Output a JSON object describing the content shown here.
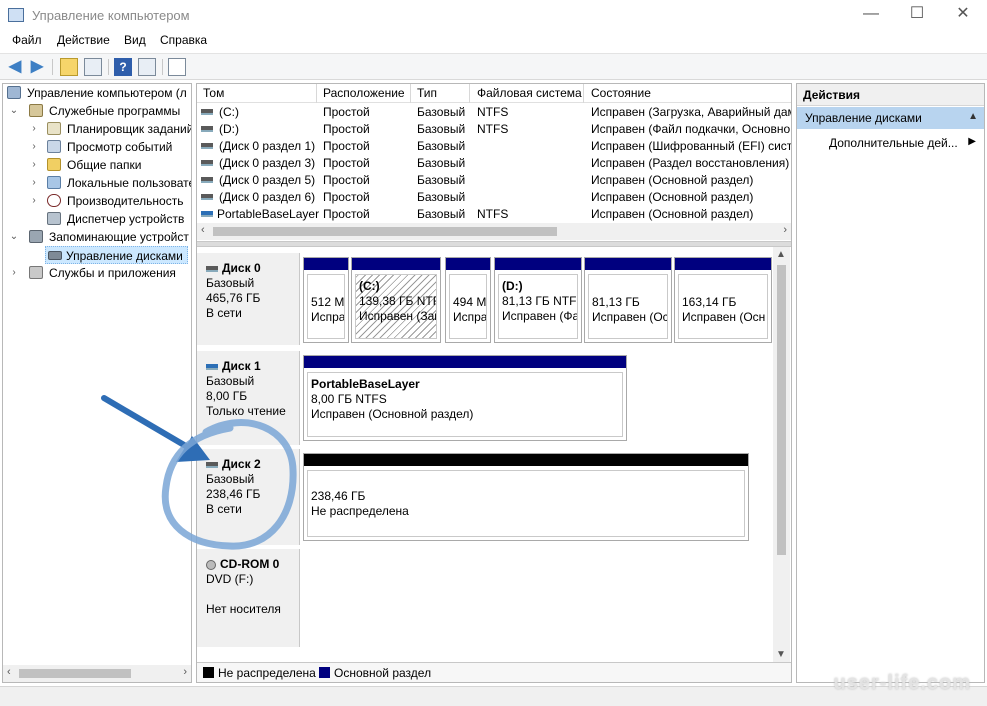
{
  "window": {
    "title": "Управление компьютером",
    "minimize": "—",
    "maximize": "☐",
    "close": "✕"
  },
  "menu": [
    "Файл",
    "Действие",
    "Вид",
    "Справка"
  ],
  "toolbar": {
    "back_icon": "back-arrow-icon",
    "forward_icon": "forward-arrow-icon",
    "help_label": "?"
  },
  "tree": {
    "items": [
      {
        "label": "Управление компьютером (л",
        "indent": 0,
        "expander": ""
      },
      {
        "label": "Служебные программы",
        "indent": 1,
        "expander": "⌄"
      },
      {
        "label": "Планировщик заданий",
        "indent": 2,
        "expander": "›"
      },
      {
        "label": "Просмотр событий",
        "indent": 2,
        "expander": "›"
      },
      {
        "label": "Общие папки",
        "indent": 2,
        "expander": "›"
      },
      {
        "label": "Локальные пользовате",
        "indent": 2,
        "expander": "›"
      },
      {
        "label": "Производительность",
        "indent": 2,
        "expander": "›"
      },
      {
        "label": "Диспетчер устройств",
        "indent": 2,
        "expander": ""
      },
      {
        "label": "Запоминающие устройст",
        "indent": 1,
        "expander": "⌄"
      },
      {
        "label": "Управление дисками",
        "indent": 2,
        "expander": "",
        "selected": true
      },
      {
        "label": "Службы и приложения",
        "indent": 1,
        "expander": "›"
      }
    ]
  },
  "volumes": {
    "columns": [
      "Том",
      "Расположение",
      "Тип",
      "Файловая система",
      "Состояние"
    ],
    "rows": [
      [
        "(C:)",
        "Простой",
        "Базовый",
        "NTFS",
        "Исправен (Загрузка, Аварийный дам"
      ],
      [
        "(D:)",
        "Простой",
        "Базовый",
        "NTFS",
        "Исправен (Файл подкачки, Основно"
      ],
      [
        "(Диск 0 раздел 1)",
        "Простой",
        "Базовый",
        "",
        "Исправен (Шифрованный (EFI) систе"
      ],
      [
        "(Диск 0 раздел 3)",
        "Простой",
        "Базовый",
        "",
        "Исправен (Раздел восстановления)"
      ],
      [
        "(Диск 0 раздел 5)",
        "Простой",
        "Базовый",
        "",
        "Исправен (Основной раздел)"
      ],
      [
        "(Диск 0 раздел 6)",
        "Простой",
        "Базовый",
        "",
        "Исправен (Основной раздел)"
      ],
      [
        "PortableBaseLayer",
        "Простой",
        "Базовый",
        "NTFS",
        "Исправен (Основной раздел)"
      ]
    ]
  },
  "disks": {
    "disk0": {
      "name": "Диск 0",
      "type": "Базовый",
      "size": "465,76 ГБ",
      "status": "В сети",
      "parts": [
        {
          "title": "",
          "size": "512 М",
          "status": "Испра"
        },
        {
          "title": "(C:)",
          "size": "139,38 ГБ NTFS",
          "status": "Исправен (Заг"
        },
        {
          "title": "",
          "size": "494 М",
          "status": "Испра"
        },
        {
          "title": "(D:)",
          "size": "81,13 ГБ NTFS",
          "status": "Исправен (Фа"
        },
        {
          "title": "",
          "size": "81,13 ГБ",
          "status": "Исправен (Ос"
        },
        {
          "title": "",
          "size": "163,14 ГБ",
          "status": "Исправен (Осн"
        }
      ]
    },
    "disk1": {
      "name": "Диск 1",
      "type": "Базовый",
      "size": "8,00 ГБ",
      "status": "Только чтение",
      "part": {
        "title": "PortableBaseLayer",
        "size": "8,00 ГБ NTFS",
        "status": "Исправен (Основной раздел)"
      }
    },
    "disk2": {
      "name": "Диск 2",
      "type": "Базовый",
      "size": "238,46 ГБ",
      "status": "В сети",
      "part": {
        "size": "238,46 ГБ",
        "status": "Не распределена"
      }
    },
    "cdrom": {
      "name": "CD-ROM 0",
      "type": "DVD (F:)",
      "status": "Нет носителя"
    }
  },
  "legend": {
    "unallocated": "Не распределена",
    "primary": "Основной раздел",
    "unallocated_color": "#000000",
    "primary_color": "#00007f"
  },
  "actions": {
    "header": "Действия",
    "group": "Управление дисками",
    "item": "Дополнительные дей..."
  },
  "watermark": "user-life.com",
  "annotation_color": "#3d7fc4"
}
